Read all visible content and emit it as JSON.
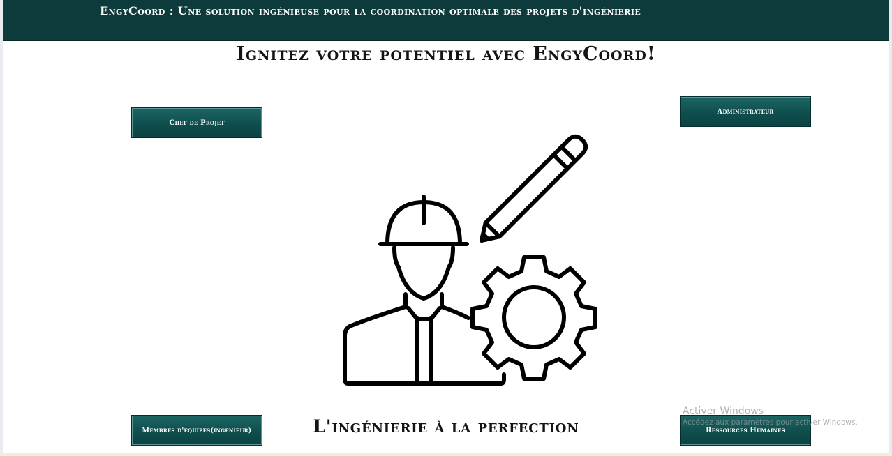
{
  "header": {
    "title": "EngyCoord : Une solution ingénieuse pour la coordination optimale des projets d'ingénierie"
  },
  "hero": {
    "title": "Ignitez votre potentiel avec EngyCoord!"
  },
  "buttons": {
    "chef_de_projet": "Chef de Projet",
    "administrateur": "Administrateur",
    "membres_equipes": "Membres d'equipes(ingenieur)",
    "ressources_humaines": "Ressources Humaines"
  },
  "tagline": "L'ingénierie à la perfection",
  "watermark": {
    "title": "Activer Windows",
    "subtitle": "Accédez aux paramètres pour activer Windows."
  },
  "illustration": {
    "icon": "engineer-with-gear-and-pencil"
  },
  "colors": {
    "header_bg": "#0d3a3a",
    "button_bg": "#0f4e4d",
    "text": "#141414"
  }
}
